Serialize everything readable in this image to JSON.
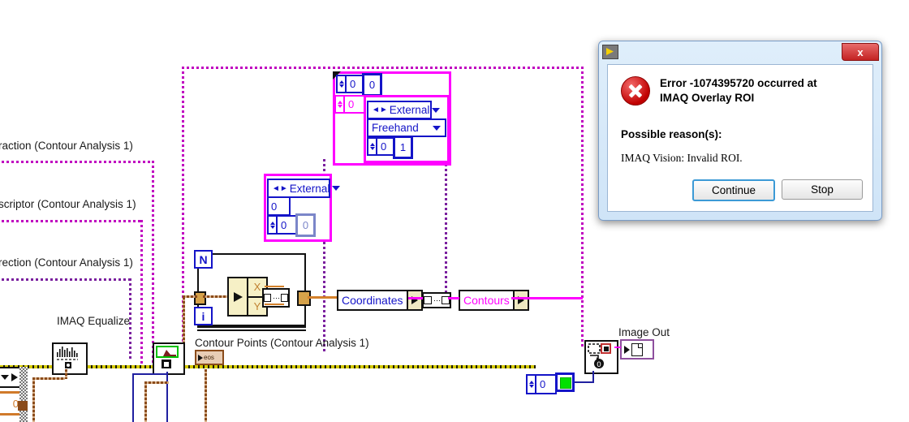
{
  "diagram": {
    "labels": {
      "extraction": "raction (Contour Analysis 1)",
      "descriptor": "scriptor (Contour Analysis 1)",
      "direction": "rection (Contour Analysis 1)",
      "imaq_equalize": "IMAQ Equalize",
      "contour_points": "Contour Points (Contour Analysis 1)",
      "image_out": "Image Out"
    },
    "terminals": {
      "coordinates": "Coordinates",
      "contours": "Contours"
    },
    "cluster_top": {
      "num1": "0",
      "num2": "0",
      "num3": "0",
      "enum_external": "External",
      "enum_freehand": "Freehand",
      "num4": "0",
      "num5": "1"
    },
    "cluster_mid": {
      "enum_external": "External",
      "num1": "0",
      "num2": "0",
      "num3": "0"
    },
    "forloop": {
      "count_terminal": "N",
      "index_terminal": "i",
      "unbundle_x": "X",
      "unbundle_y": "Y"
    },
    "overlay": {
      "offset_constant": "0",
      "boolean_constant": "TRUE"
    },
    "error_terminal_text": "eos",
    "colors": {
      "magenta_wire": "#ff00ff",
      "purple_wire": "#7a1f9e",
      "blue_wire": "#2020a0",
      "orange_wire": "#d4812b",
      "error_wire": "#d4c900",
      "boolean_true": "#00e000"
    }
  },
  "dialog": {
    "title": "",
    "close_label": "x",
    "error_message": "Error -1074395720 occurred at IMAQ Overlay ROI",
    "reason_heading": "Possible reason(s):",
    "reason_text": "IMAQ Vision:  Invalid ROI.",
    "buttons": {
      "continue": "Continue",
      "stop": "Stop"
    }
  }
}
